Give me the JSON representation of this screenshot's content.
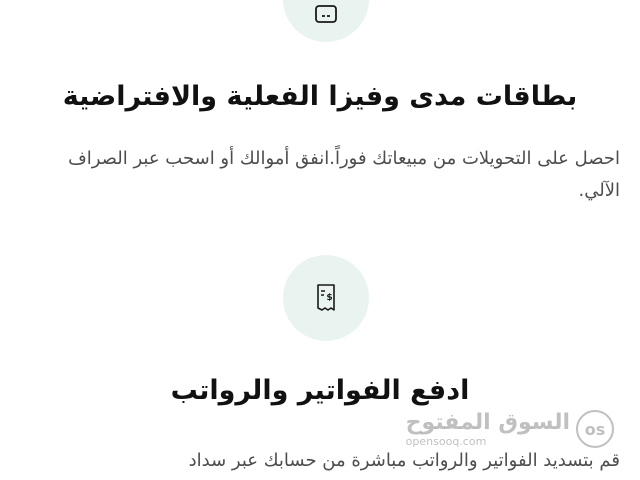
{
  "sections": [
    {
      "icon": "card-icon",
      "title": "بطاقات مدى وفيزا الفعلية والافتراضية",
      "description": "احصل على التحويلات من مبيعاتك فوراً.انفق أموالك أو اسحب عبر الصراف الآلي."
    },
    {
      "icon": "receipt-icon",
      "title": "ادفع الفواتير والرواتب",
      "description": "قم بتسديد الفواتير والرواتب مباشرة من حسابك عبر سداد"
    }
  ],
  "watermark": {
    "arabic": "السوق المفتوح",
    "latin": "opensooq.com",
    "logo": "os"
  },
  "colors": {
    "icon_bg": "#e9f3ef",
    "icon_stroke": "#1a1a1a",
    "title": "#111111",
    "description": "#4d4d4d"
  }
}
